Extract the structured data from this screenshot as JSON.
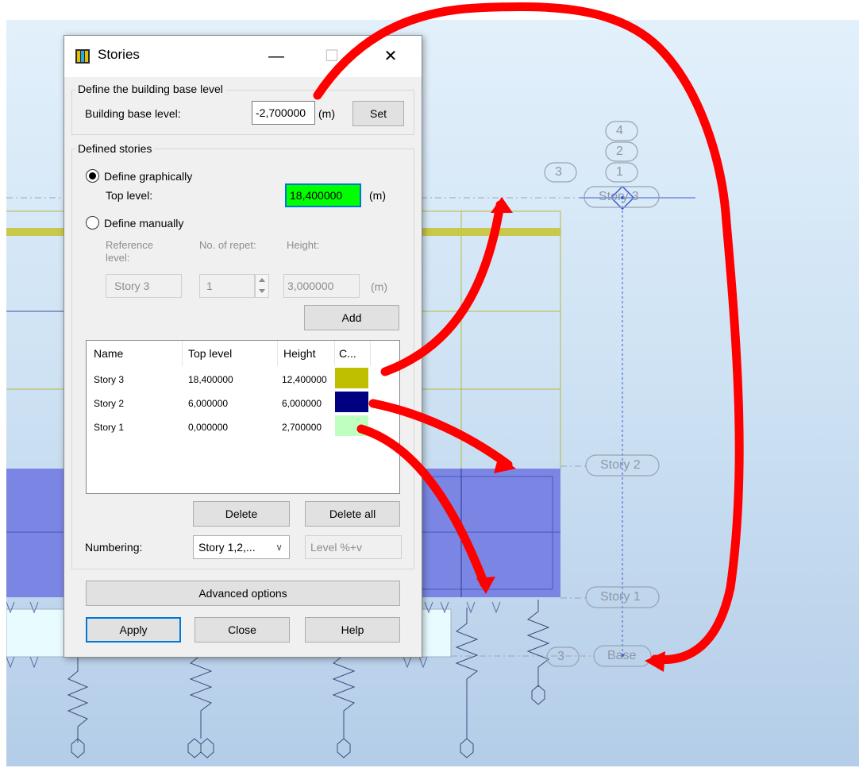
{
  "viewport": {
    "story_labels": [
      {
        "id": "story-3",
        "text": "Story 3"
      },
      {
        "id": "story-2",
        "text": "Story 2"
      },
      {
        "id": "story-1",
        "text": "Story 1"
      },
      {
        "id": "base",
        "text": "Base"
      }
    ],
    "axis_bubbles": [
      "4",
      "2",
      "1",
      "3",
      "3"
    ]
  },
  "dialog": {
    "title": "Stories",
    "window_buttons": {
      "minimize": "—",
      "maximize": "☐",
      "close": "✕"
    },
    "base_group": {
      "title": "Define the building base level",
      "base_label": "Building base level:",
      "base_value": "-2,700000",
      "unit": "(m)",
      "set_label": "Set"
    },
    "stories_group": {
      "title": "Defined stories",
      "graphical_label": "Define graphically",
      "top_level_label": "Top level:",
      "top_level_value": "18,400000",
      "top_unit": "(m)",
      "manual_label": "Define manually",
      "ref_header": "Reference level:",
      "reps_header": "No. of repet:",
      "height_header": "Height:",
      "ref_value": "Story 3",
      "reps_value": "1",
      "height_value": "3,000000",
      "height_unit": "(m)",
      "add_label": "Add"
    },
    "list": {
      "headers": [
        "Name",
        "Top level",
        "Height",
        "C..."
      ],
      "rows": [
        {
          "name": "Story 3",
          "top": "18,400000",
          "height": "12,400000",
          "color": "#bfbf00"
        },
        {
          "name": "Story 2",
          "top": "6,000000",
          "height": "6,000000",
          "color": "#000080"
        },
        {
          "name": "Story 1",
          "top": "0,000000",
          "height": "2,700000",
          "color": "#bfffbf"
        }
      ]
    },
    "delete_label": "Delete",
    "delete_all_label": "Delete all",
    "numbering_label": "Numbering:",
    "numbering_value": "Story 1,2,...",
    "level_pattern": "Level %+v",
    "advanced_label": "Advanced options",
    "apply_label": "Apply",
    "close_label": "Close",
    "help_label": "Help"
  },
  "colors": {
    "top_level_highlight": "#00ff00",
    "annotation_arrows": "#ff0000",
    "slab_fill": "#7b86e4"
  }
}
